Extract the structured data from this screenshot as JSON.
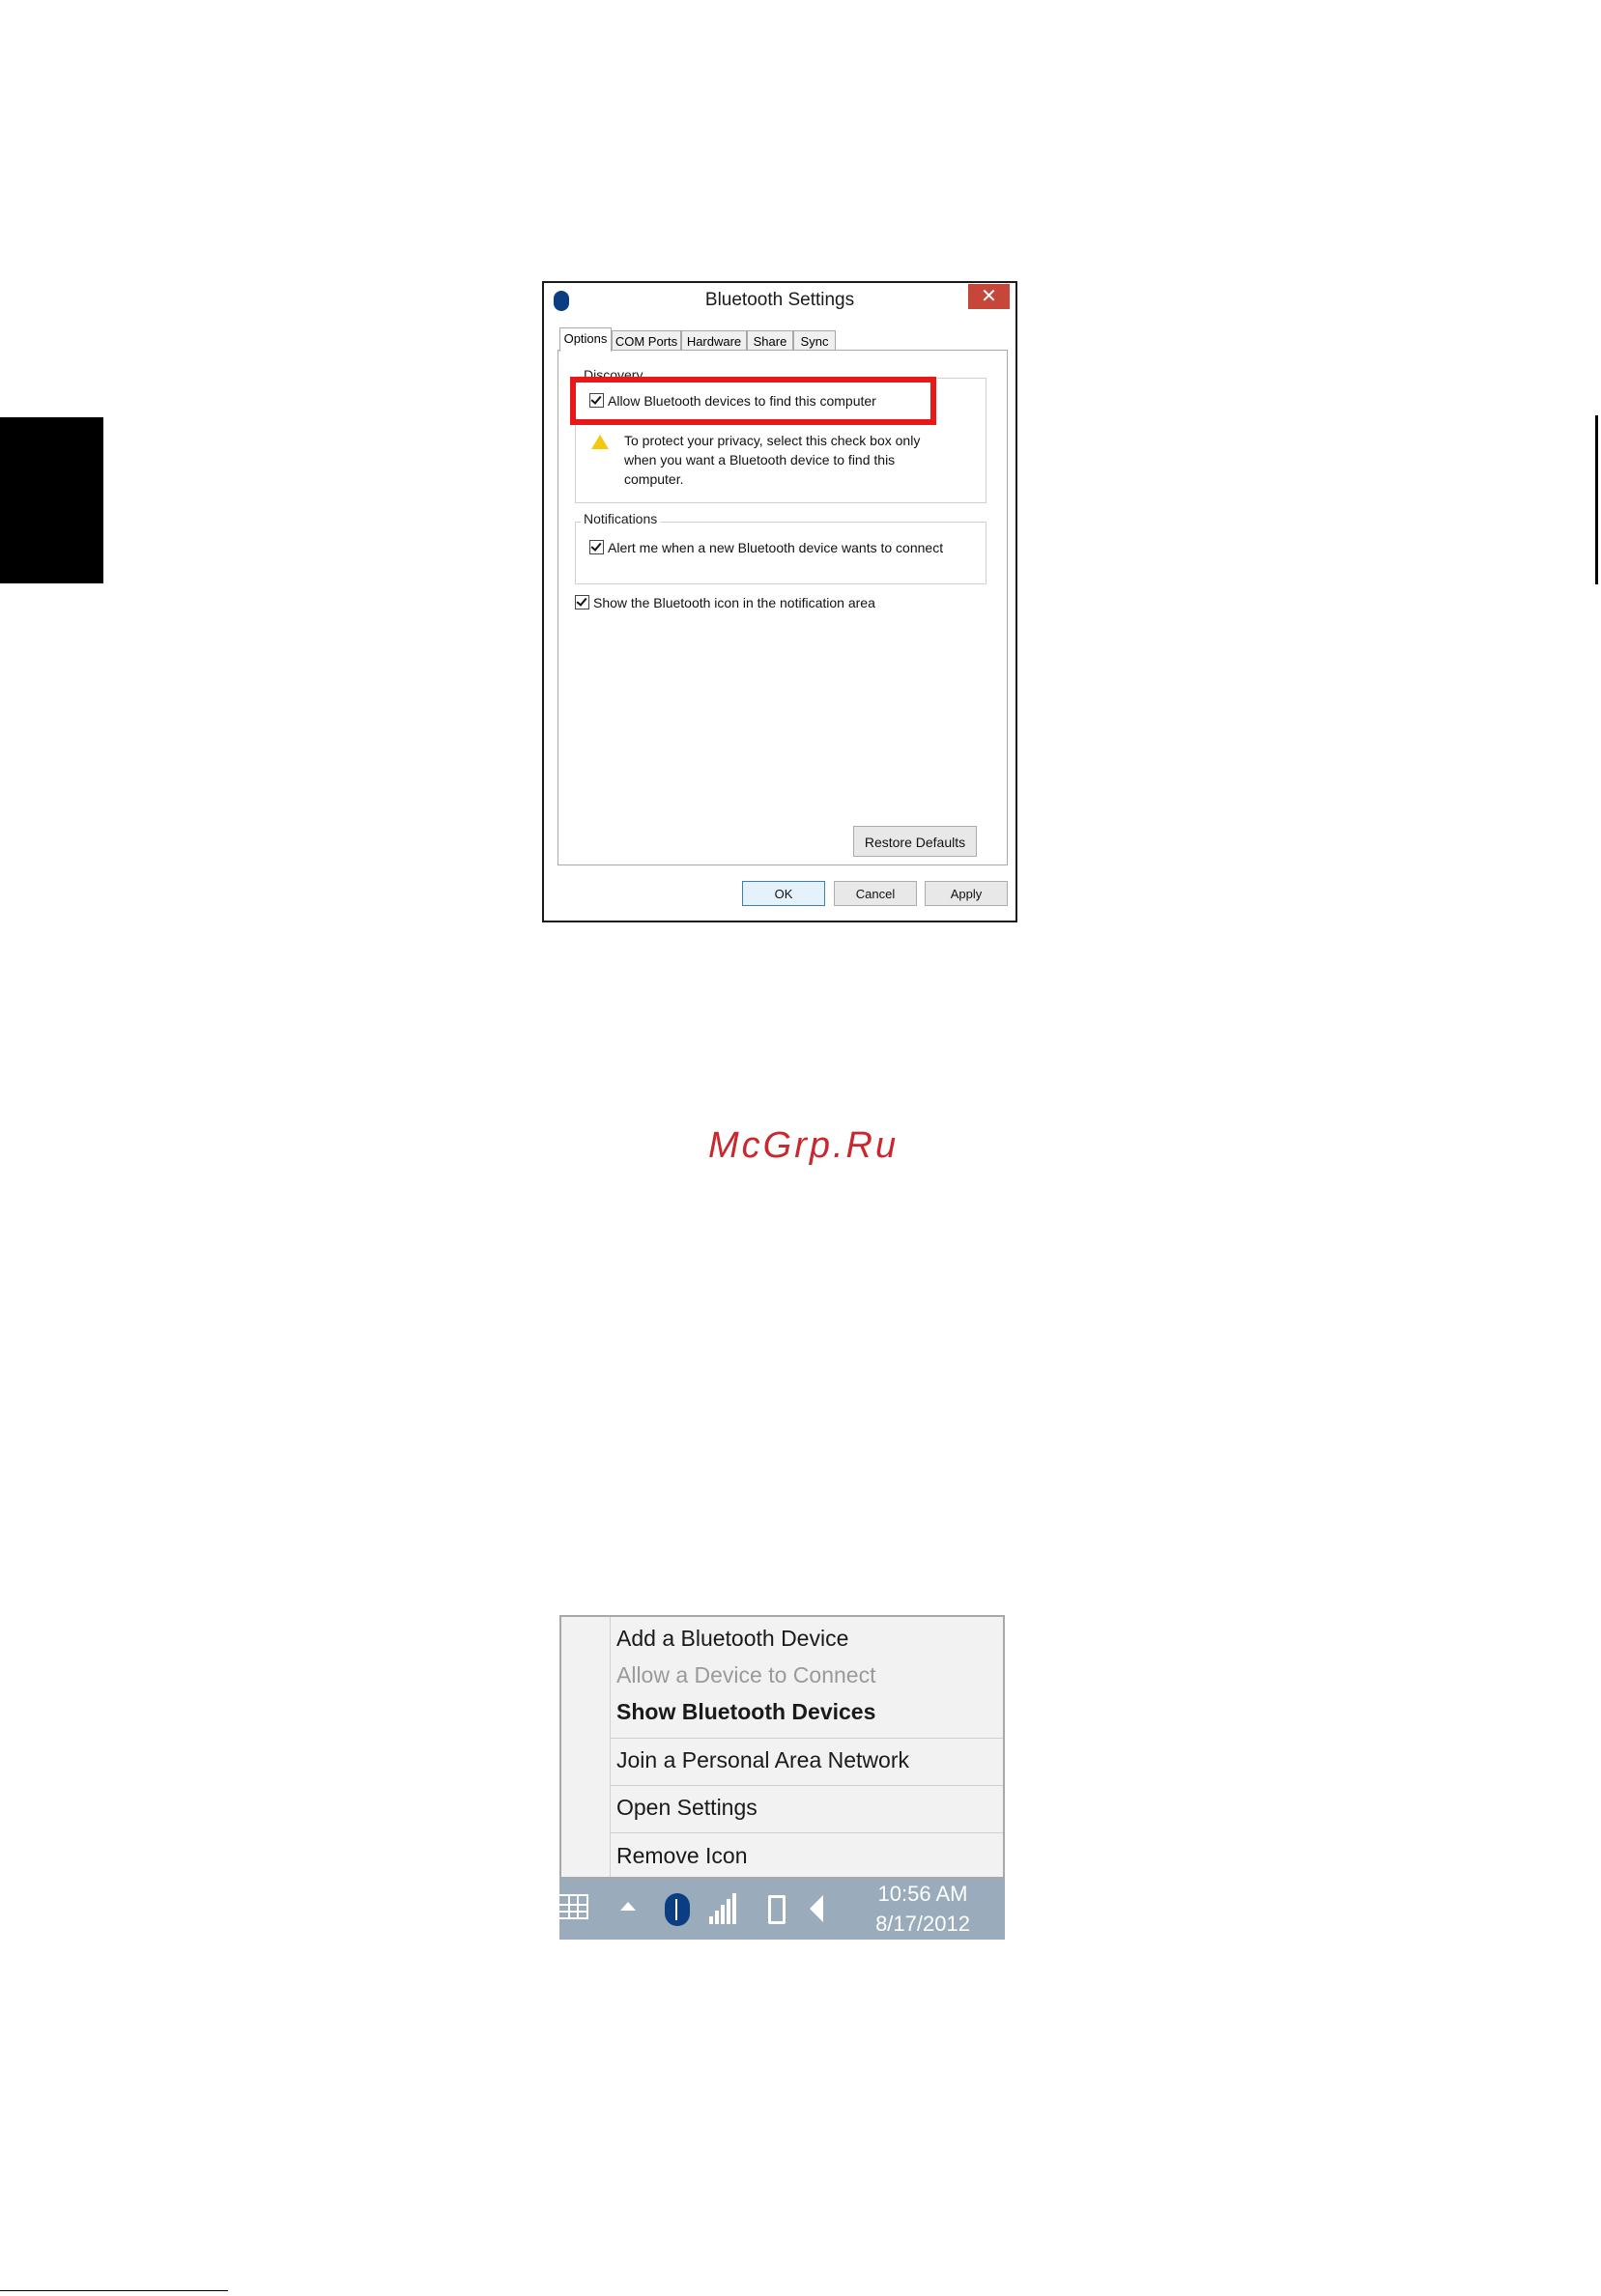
{
  "dialog": {
    "title": "Bluetooth Settings",
    "close_label": "✕",
    "tabs": [
      "Options",
      "COM Ports",
      "Hardware",
      "Share",
      "Sync"
    ],
    "discovery": {
      "group_label": "Discovery",
      "allow_label": "Allow Bluetooth devices to find this computer",
      "allow_checked": true,
      "warning_text": "To protect your privacy, select this check box only when you want a Bluetooth device to find this computer."
    },
    "notifications": {
      "group_label": "Notifications",
      "alert_label": "Alert me when a new Bluetooth device wants to connect",
      "alert_checked": true
    },
    "show_icon_label": "Show the Bluetooth icon in the notification area",
    "show_icon_checked": true,
    "restore_defaults_label": "Restore Defaults",
    "ok_label": "OK",
    "cancel_label": "Cancel",
    "apply_label": "Apply"
  },
  "watermark": "McGrp.Ru",
  "context_menu": {
    "items": [
      {
        "label": "Add a Bluetooth Device",
        "state": "normal"
      },
      {
        "label": "Allow a Device to Connect",
        "state": "disabled"
      },
      {
        "label": "Show Bluetooth Devices",
        "state": "bold"
      },
      {
        "label": "Join a Personal Area Network",
        "state": "normal"
      },
      {
        "label": "Open Settings",
        "state": "normal"
      },
      {
        "label": "Remove Icon",
        "state": "normal"
      }
    ]
  },
  "taskbar": {
    "time": "10:56 AM",
    "date": "8/17/2012",
    "icons": [
      "keyboard-icon",
      "show-hidden-icons-icon",
      "bluetooth-icon",
      "network-signal-icon",
      "battery-icon",
      "volume-icon"
    ]
  },
  "colors": {
    "highlight": "#e81818",
    "close_button": "#c7463a",
    "taskbar": "#9aacbb",
    "watermark": "#c8282e",
    "bluetooth": "#0b3d82"
  }
}
